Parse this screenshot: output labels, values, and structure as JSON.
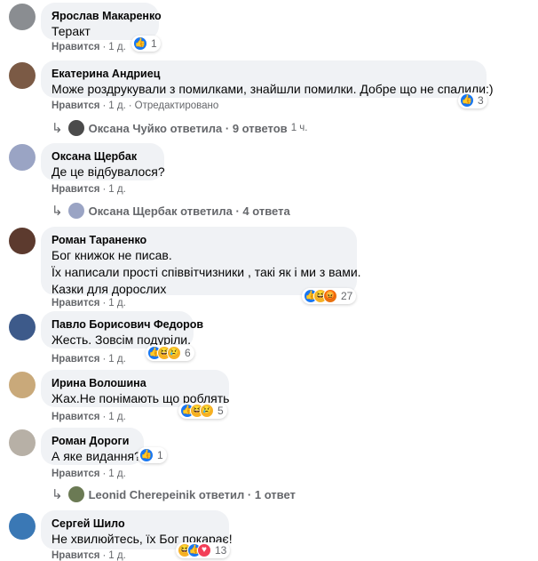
{
  "comments": [
    {
      "author": "Ярослав Макаренко",
      "lines": [
        "Теракт"
      ],
      "like": "Нравится",
      "time": "1 д.",
      "reactions": {
        "count": "1"
      }
    },
    {
      "author": "Екатерина Андриец",
      "lines": [
        "Може роздрукували з помилками, знайшли помилки. Добре що не спалили:)"
      ],
      "like": "Нравится",
      "time": "1 д.",
      "edited": "Отредактировано",
      "reactions": {
        "count": "3"
      },
      "reply": {
        "text": "Оксана Чуйко ответила · 9 ответов",
        "time": "1 ч."
      }
    },
    {
      "author": "Оксана Щербак",
      "lines": [
        "Де це відбувалося?"
      ],
      "like": "Нравится",
      "time": "1 д.",
      "reply": {
        "text": "Оксана Щербак ответила · 4 ответа",
        "time": ""
      }
    },
    {
      "author": "Роман Тараненко",
      "lines": [
        "Бог книжок не писав.",
        "Їх написали прості співвітчизники , такі як і ми з вами.",
        "Казки для дорослих"
      ],
      "like": "Нравится",
      "time": "1 д.",
      "reactions": {
        "count": "27"
      }
    },
    {
      "author": "Павло Борисович Федоров",
      "lines": [
        "Жесть. Зовсім подуріли."
      ],
      "like": "Нравится",
      "time": "1 д.",
      "reactions": {
        "count": "6"
      }
    },
    {
      "author": "Ирина Волошина",
      "lines": [
        "Жах.Не понімають що роблять"
      ],
      "like": "Нравится",
      "time": "1 д.",
      "reactions": {
        "count": "5"
      }
    },
    {
      "author": "Роман Дороги",
      "lines": [
        "А яке видання?"
      ],
      "like": "Нравится",
      "time": "1 д.",
      "reactions": {
        "count": "1"
      },
      "reply": {
        "text": "Leonid Cherepeinik ответил · 1 ответ",
        "time": ""
      }
    },
    {
      "author": "Сергей Шило",
      "lines": [
        "Не хвилюйтесь, їх Бог покарає!"
      ],
      "like": "Нравится",
      "time": "1 д.",
      "reactions": {
        "count": "13"
      }
    }
  ],
  "colors": {
    "bubble": "#f0f2f5",
    "meta": "#65676b",
    "like": "#1877f2"
  }
}
